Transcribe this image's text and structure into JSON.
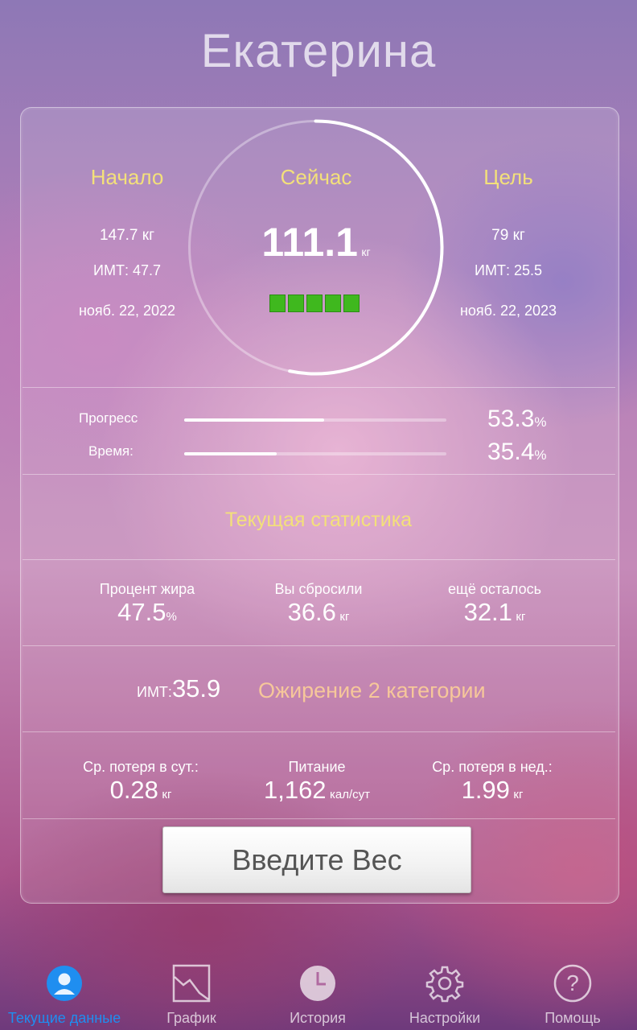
{
  "header": {
    "name": "Екатерина"
  },
  "start": {
    "label": "Начало",
    "weight": "147.7 кг",
    "bmi": "ИМТ: 47.7",
    "date": "нояб. 22, 2022"
  },
  "now": {
    "label": "Сейчас",
    "weight": "111.1",
    "unit": "кг",
    "segments": 5
  },
  "goal": {
    "label": "Цель",
    "weight": "79 кг",
    "bmi": "ИМТ: 25.5",
    "date": "нояб. 22, 2023"
  },
  "progress": {
    "label": "Прогресс",
    "value": "53.3",
    "unit": "%",
    "fraction": 0.533
  },
  "time": {
    "label": "Время:",
    "value": "35.4",
    "unit": "%",
    "fraction": 0.354
  },
  "section_title": "Текущая статистика",
  "stats1": [
    {
      "label": "Процент жира",
      "value": "47.5",
      "unit": "%"
    },
    {
      "label": "Вы сбросили",
      "value": "36.6",
      "unit": "кг"
    },
    {
      "label": "ещё осталось",
      "value": "32.1",
      "unit": "кг"
    }
  ],
  "bmi_row": {
    "label": "ИМТ:",
    "value": "35.9",
    "category": "Ожирение 2 категории"
  },
  "stats2": [
    {
      "label": "Ср. потеря в сут.:",
      "value": "0.28",
      "unit": "кг"
    },
    {
      "label": "Питание",
      "value": "1,162",
      "unit": "кал/сут"
    },
    {
      "label": "Ср. потеря в нед.:",
      "value": "1.99",
      "unit": "кг"
    }
  ],
  "enter_button": "Введите Вес",
  "tabs": [
    {
      "label": "Текущие данные",
      "icon": "person-icon",
      "active": true
    },
    {
      "label": "График",
      "icon": "chart-icon",
      "active": false
    },
    {
      "label": "История",
      "icon": "clock-icon",
      "active": false
    },
    {
      "label": "Настройки",
      "icon": "gear-icon",
      "active": false
    },
    {
      "label": "Помощь",
      "icon": "help-icon",
      "active": false
    }
  ],
  "colors": {
    "accent_gold": "#f3e07a",
    "category_orange": "#f6c79a",
    "active_tab": "#1f8ef0",
    "segment_green": "#3fb81e"
  }
}
